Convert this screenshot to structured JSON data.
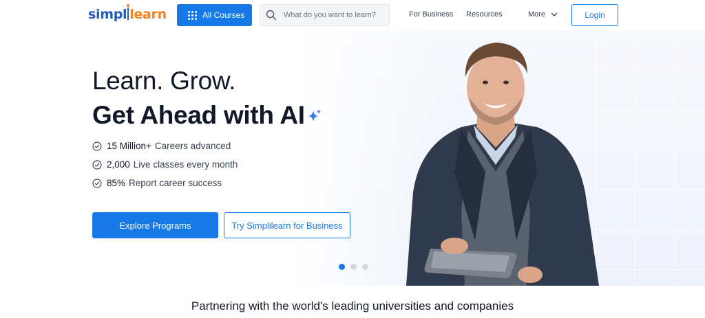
{
  "header": {
    "logo_part1": "simpl",
    "logo_part2": "learn",
    "all_courses_label": "All Courses",
    "search_placeholder": "What do you want to learn?",
    "nav_business": "For Business",
    "nav_resources": "Resources",
    "nav_more": "More",
    "login_label": "Login"
  },
  "hero": {
    "headline_line1": "Learn. Grow.",
    "headline_line2": "Get Ahead with AI",
    "stats": [
      {
        "number": "15 Million+",
        "text": "Careers advanced"
      },
      {
        "number": "2,000",
        "text": "Live classes every month"
      },
      {
        "number": "85%",
        "text": "Report career success"
      }
    ],
    "explore_button": "Explore Programs",
    "business_button": "Try Simplilearn for Business",
    "carousel_total": 3,
    "carousel_active": 1
  },
  "partners_heading": "Partnering with the world's leading universities and companies",
  "colors": {
    "brand_blue": "#1679e6",
    "logo_blue": "#1f5fbf",
    "logo_orange": "#f58220",
    "headline": "#111827"
  },
  "icons": {
    "grid": "grid-dots-icon",
    "search": "search-icon",
    "chevron": "chevron-down-icon",
    "sparkle": "sparkle-icon",
    "check": "check-circle-icon"
  }
}
